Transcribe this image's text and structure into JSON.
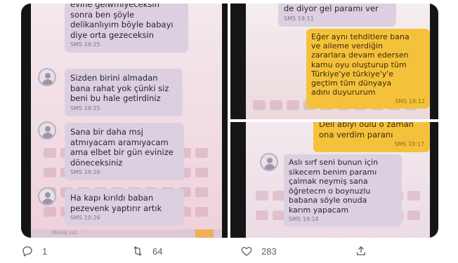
{
  "media": {
    "photo_left": {
      "messages": [
        {
          "lines": [
            "evine gelwmiyeceksin",
            "sonra ben şöyle",
            "delikanlıyım böyle babayı",
            "diye orta gezeceksin"
          ],
          "meta": "SMS 19:25"
        },
        {
          "lines": [
            "Sizden birini almadan",
            "bana rahat yok çünki siz",
            "beni bu hale getirdiniz"
          ],
          "meta": "SMS 19:25"
        },
        {
          "lines": [
            "Sana bir daha msj",
            "atmıyacam aramıyacam",
            "ama elbet bir gün evinize",
            "döneceksiniz"
          ],
          "meta": "SMS 19:26"
        },
        {
          "lines": [
            "Ha kapı kırıldı baban",
            "pezevenk yaptırır artık"
          ],
          "meta": "SMS 19:26"
        }
      ],
      "composer_hint": "Mesaj yaz",
      "avatar_icon": "contact-avatar-icon"
    },
    "photo_top_right": {
      "messages": [
        {
          "lines": [
            "de diyor gel paramı ver"
          ],
          "meta": "SMS 19:11",
          "type": "incoming"
        },
        {
          "lines": [
            "Eğer aynı tehditlere bana",
            "ve aileme verdiğin",
            "zararlara devam edersen",
            "kamu oyu oluşturup tüm",
            "Türkiye'ye türkiye'y'e",
            "geçtim tüm dünyaya",
            "adını duyururum"
          ],
          "meta": "SMS 19:12",
          "type": "outgoing"
        }
      ]
    },
    "photo_bottom_right": {
      "messages": [
        {
          "lines": [
            "Dell abiyi oulu o zaman",
            "ona verdim paranı"
          ],
          "meta": "SMS 19:17",
          "type": "outgoing"
        },
        {
          "lines": [
            "Aslı sırf seni bunun için",
            "sikecem benim paramı",
            "çalmak neymiş sana",
            "öğretecm o boynuzlu",
            "babana söyle onuda",
            "karım yapacam"
          ],
          "meta": "SMS 19:18",
          "type": "incoming"
        }
      ]
    }
  },
  "actions": {
    "reply": {
      "icon": "reply-icon",
      "count": "1"
    },
    "retweet": {
      "icon": "retweet-icon",
      "count": "64"
    },
    "like": {
      "icon": "heart-icon",
      "count": "283"
    },
    "share": {
      "icon": "share-icon"
    }
  },
  "colors": {
    "incoming_bubble": "#dcd0e0",
    "outgoing_bubble": "#f4c23a",
    "action_gray": "#536471"
  }
}
